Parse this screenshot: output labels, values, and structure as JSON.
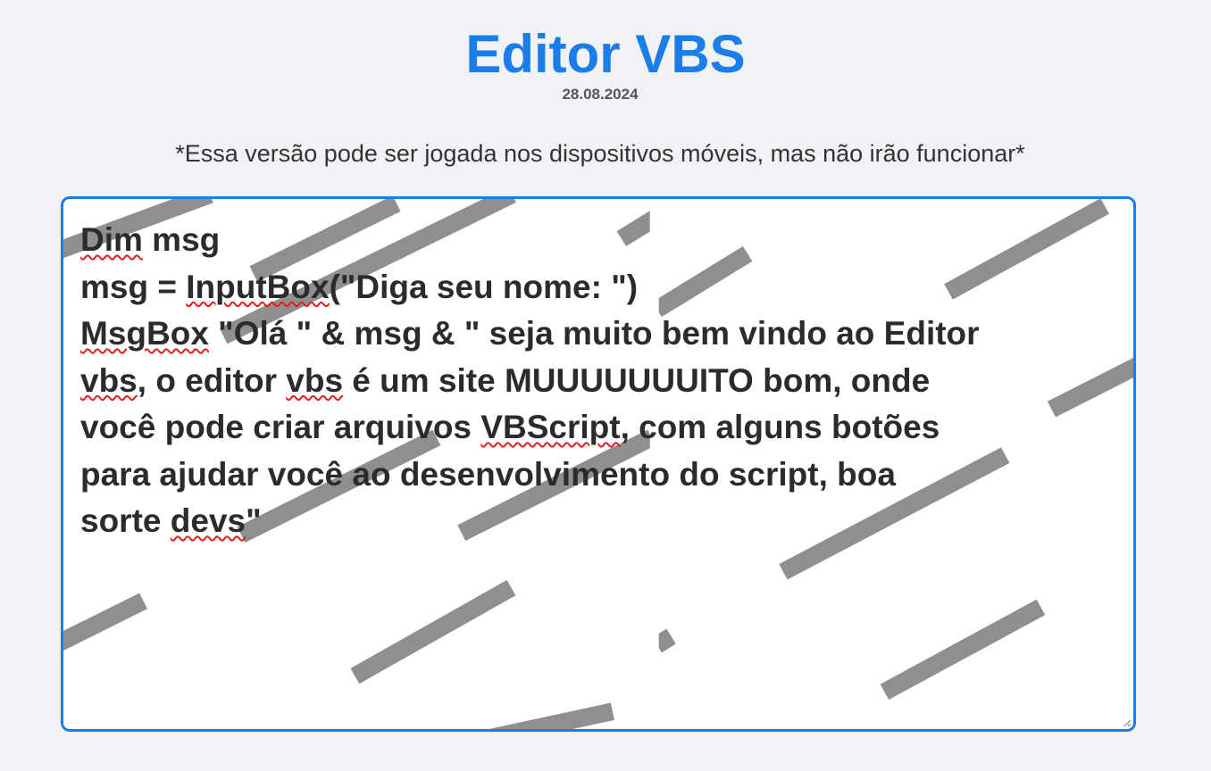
{
  "header": {
    "title": "Editor VBS",
    "date": "28.08.2024",
    "notice": "*Essa versão pode ser jogada nos dispositivos móveis, mas não irão funcionar*"
  },
  "editor": {
    "lines": [
      [
        {
          "t": "Dim",
          "s": true
        },
        {
          "t": " msg",
          "s": false
        }
      ],
      [
        {
          "t": "msg = ",
          "s": false
        },
        {
          "t": "InputBox",
          "s": true
        },
        {
          "t": "(\"Diga seu nome: \")",
          "s": false
        }
      ],
      [
        {
          "t": "MsgBox",
          "s": true
        },
        {
          "t": " \"Olá \" & msg & \" seja muito bem vindo ao Editor",
          "s": false
        }
      ],
      [
        {
          "t": "vbs",
          "s": true
        },
        {
          "t": ", o editor ",
          "s": false
        },
        {
          "t": "vbs",
          "s": true
        },
        {
          "t": " é um site MUUUUUUUITO bom, onde",
          "s": false
        }
      ],
      [
        {
          "t": "você pode criar arquivos ",
          "s": false
        },
        {
          "t": "VBScript",
          "s": true
        },
        {
          "t": ", com alguns botões",
          "s": false
        }
      ],
      [
        {
          "t": "para ajudar você ao desenvolvimento do script, boa",
          "s": false
        }
      ],
      [
        {
          "t": "sorte ",
          "s": false
        },
        {
          "t": "devs",
          "s": true
        },
        {
          "t": "\"",
          "s": false
        }
      ]
    ],
    "accent_color": "#1a7de8",
    "stripe_color": "#8f8f8f"
  }
}
